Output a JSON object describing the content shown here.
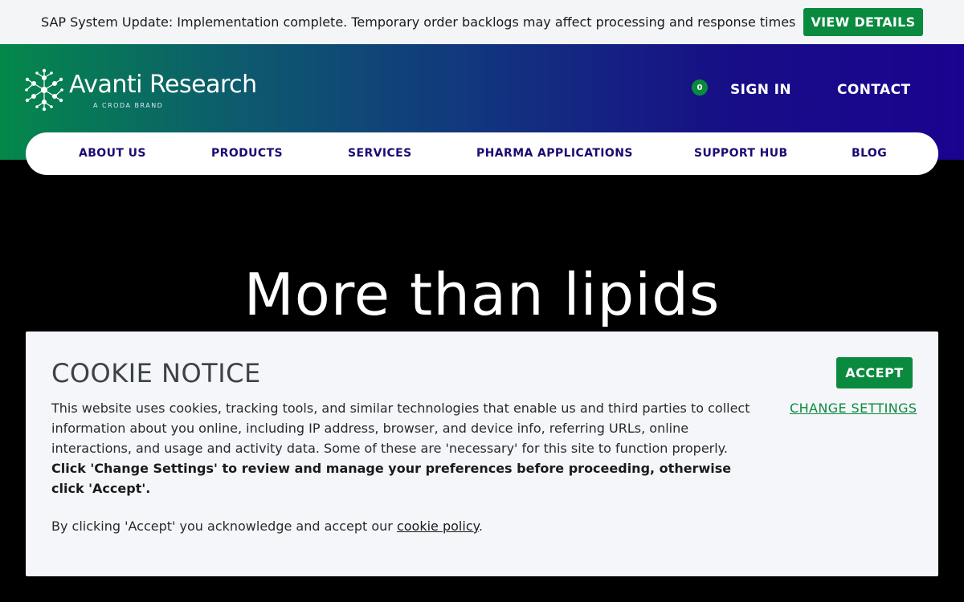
{
  "announcement": {
    "text": "SAP System Update: Implementation complete. Temporary order backlogs may affect processing and response times",
    "button": "VIEW DETAILS"
  },
  "header": {
    "logo_text": "Avanti Research",
    "logo_sub": "A CRODA BRAND",
    "cart_count": "0",
    "signin": "SIGN IN",
    "contact": "CONTACT"
  },
  "nav": {
    "items": [
      "ABOUT US",
      "PRODUCTS",
      "SERVICES",
      "PHARMA APPLICATIONS",
      "SUPPORT HUB",
      "BLOG"
    ]
  },
  "hero": {
    "title": "More than lipids"
  },
  "cookie": {
    "title": "COOKIE NOTICE",
    "body": "This website uses cookies, tracking tools, and similar technologies that enable us and third parties to collect information about you online, including IP address, browser, and device info, referring URLs, online interactions, and usage and activity data. Some of these are 'necessary' for this site to function properly.",
    "bold": "Click 'Change Settings' to review and manage your preferences before proceeding, otherwise click 'Accept'.",
    "foot_prefix": "By clicking 'Accept' you acknowledge and accept our ",
    "foot_link": "cookie policy",
    "foot_suffix": ".",
    "accept": "ACCEPT",
    "change": "CHANGE SETTINGS"
  },
  "colors": {
    "accent_green": "#0a8a3e",
    "nav_text": "#1c0a73",
    "header_gradient_start": "#04884a",
    "header_gradient_end": "#1a0390"
  }
}
